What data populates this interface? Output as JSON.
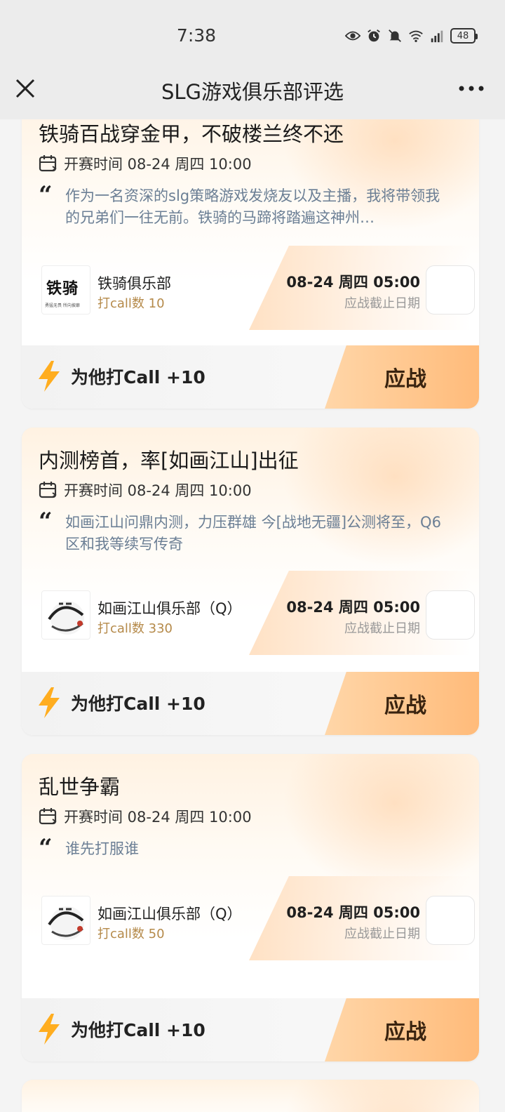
{
  "status_bar": {
    "time": "7:38",
    "battery": "48"
  },
  "navbar": {
    "title": "SLG游戏俱乐部评选"
  },
  "cards": [
    {
      "title": "铁骑百战穿金甲，不破楼兰终不还",
      "match_time": "开赛时间 08-24 周四 10:00",
      "description": "作为一名资深的slg策略游戏发烧友以及主播，我将带领我的兄弟们一往无前。铁骑的马蹄将踏遍这神州…",
      "club": {
        "logo_text": "铁骑",
        "logo_sub": "勇猛无畏 所向披靡",
        "name": "铁骑俱乐部",
        "calls": "打call数 10"
      },
      "deadline": {
        "date": "08-24 周四 05:00",
        "label": "应战截止日期"
      },
      "call_label": "为他打Call +10",
      "fight_label": "应战"
    },
    {
      "title": "内测榜首，率[如画江山]出征",
      "match_time": "开赛时间 08-24 周四 10:00",
      "description": "如画江山问鼎内测，力压群雄 今[战地无疆]公测将至，Q6区和我等续写传奇",
      "club": {
        "name": "如画江山俱乐部（Q）",
        "calls": "打call数 330"
      },
      "deadline": {
        "date": "08-24 周四 05:00",
        "label": "应战截止日期"
      },
      "call_label": "为他打Call +10",
      "fight_label": "应战"
    },
    {
      "title": "乱世争霸",
      "match_time": "开赛时间 08-24 周四 10:00",
      "description": "谁先打服谁",
      "club": {
        "name": "如画江山俱乐部（Q）",
        "calls": "打call数 50"
      },
      "deadline": {
        "date": "08-24 周四 05:00",
        "label": "应战截止日期"
      },
      "call_label": "为他打Call +10",
      "fight_label": "应战"
    }
  ]
}
